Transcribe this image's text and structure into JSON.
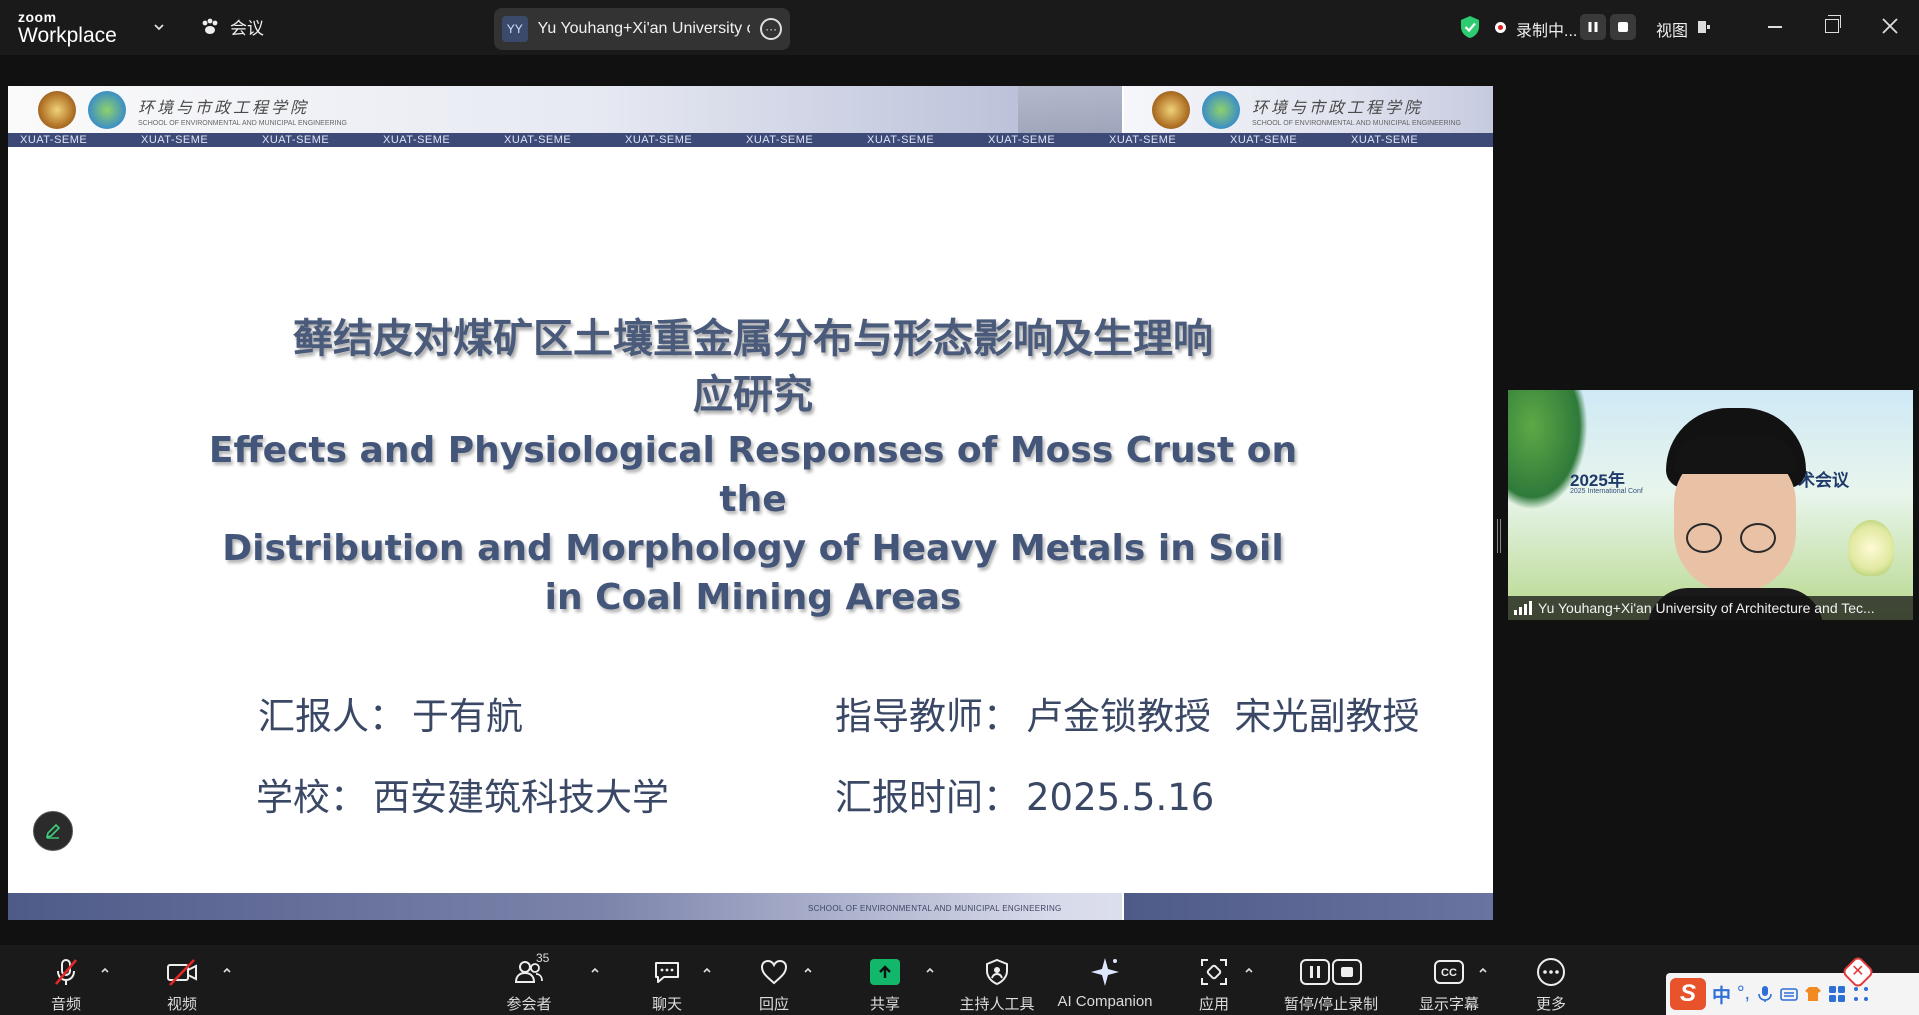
{
  "app": {
    "brand": "zoom",
    "product": "Workplace",
    "meeting_label": "会议"
  },
  "topbar": {
    "speaker_initials": "YY",
    "speaker_name": "Yu Youhang+Xi'an University of A",
    "recording_label": "录制中...",
    "view_label": "视图",
    "colors": {
      "shield": "#2ecc71",
      "record_dot": "#e02020"
    }
  },
  "slide": {
    "header_school_cn": "环境与市政工程学院",
    "header_school_en": "SCHOOL OF ENVIRONMENTAL AND MUNICIPAL ENGINEERING",
    "header_strip": [
      "XUAT-SEME",
      "XUAT-SEME",
      "XUAT-SEME",
      "XUAT-SEME",
      "XUAT-SEME",
      "XUAT-SEME",
      "XUAT-SEME",
      "XUAT-SEME",
      "XUAT-SEME",
      "XUAT-SEME",
      "XUAT-SEME",
      "XUAT-SEME"
    ],
    "title_cn_line1": "藓结皮对煤矿区土壤重金属分布与形态影响及生理响",
    "title_cn_line2": "应研究",
    "title_en_line1": "Effects and Physiological Responses of Moss Crust on",
    "title_en_line2": "the",
    "title_en_line3": "Distribution and Morphology of Heavy Metals in Soil",
    "title_en_line4": "in Coal Mining Areas",
    "presenter_label": "汇报人：",
    "presenter": "于有航",
    "advisor_label": "指导教师：",
    "advisors": "卢金锁教授  宋光副教授",
    "school_label": "学校：",
    "school": "西安建筑科技大学",
    "date_label": "汇报时间：",
    "date": "2025.5.16",
    "footer_text": "SCHOOL OF ENVIRONMENTAL AND MUNICIPAL ENGINEERING"
  },
  "video": {
    "banner_left": "2025年",
    "banner_right": "术会议",
    "banner_sub": "2025 International Conf",
    "name": "Yu Youhang+Xi'an University of Architecture and Tec..."
  },
  "toolbar": {
    "items": [
      {
        "label": "音频",
        "icon": "mic-muted-icon"
      },
      {
        "label": "视频",
        "icon": "video-off-icon"
      },
      {
        "label": "参会者",
        "icon": "participants-icon",
        "count": "35"
      },
      {
        "label": "聊天",
        "icon": "chat-icon"
      },
      {
        "label": "回应",
        "icon": "heart-icon"
      },
      {
        "label": "共享",
        "icon": "share-screen-icon"
      },
      {
        "label": "主持人工具",
        "icon": "host-tools-icon"
      },
      {
        "label": "AI Companion",
        "icon": "ai-sparkle-icon"
      },
      {
        "label": "应用",
        "icon": "apps-icon"
      },
      {
        "label": "暂停/停止录制",
        "icon": "pause-stop-record-icon"
      },
      {
        "label": "显示字幕",
        "icon": "captions-icon"
      },
      {
        "label": "更多",
        "icon": "more-icon"
      }
    ]
  },
  "ime": {
    "logo": "S",
    "mode": "中",
    "punct": "°,"
  }
}
